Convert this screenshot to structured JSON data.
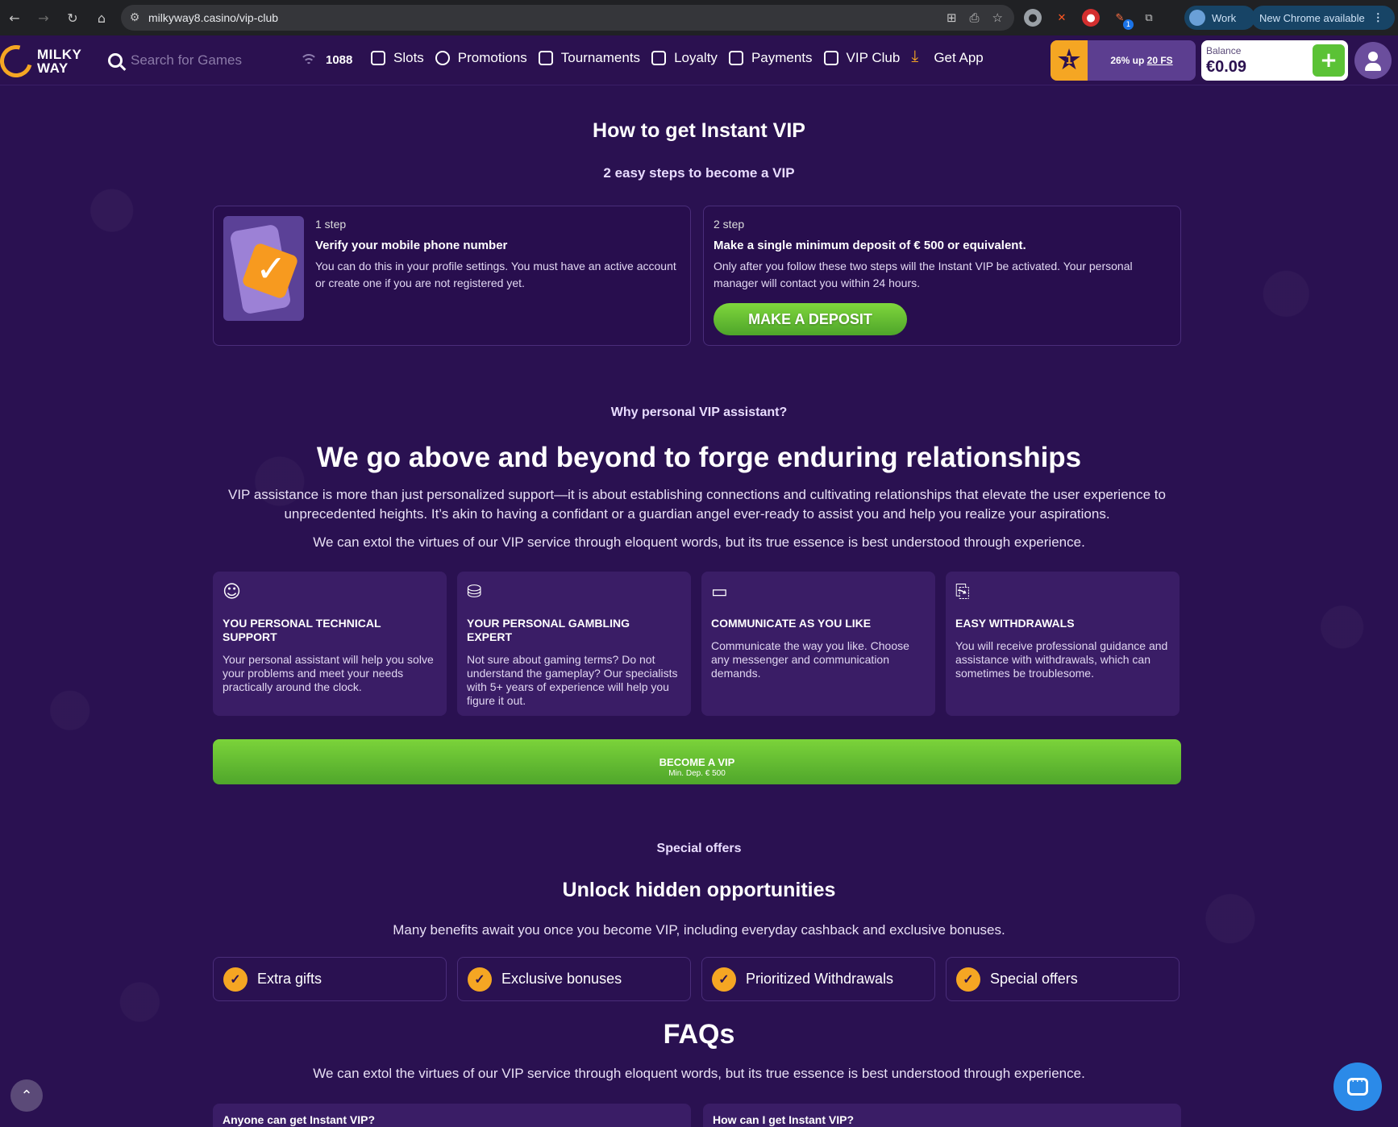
{
  "browser": {
    "url": "milkyway8.casino/vip-club",
    "profile_label": "Work",
    "update_label": "New Chrome available",
    "extension_badge": "1"
  },
  "header": {
    "logo_line1": "MILKY",
    "logo_line2": "WAY",
    "search_placeholder": "Search for Games",
    "online_count": "1088",
    "nav": [
      {
        "label": "Slots",
        "icon": "slot-machine-icon"
      },
      {
        "label": "Promotions",
        "icon": "promotion-icon"
      },
      {
        "label": "Tournaments",
        "icon": "trophy-icon"
      },
      {
        "label": "Loyalty",
        "icon": "loyalty-icon"
      },
      {
        "label": "Payments",
        "icon": "wallet-icon"
      },
      {
        "label": "VIP Club",
        "icon": "vip-icon"
      },
      {
        "label": "Get App",
        "icon": "download-icon"
      }
    ],
    "loyalty": {
      "level": "1",
      "text_pre": "26% up",
      "text_link": "20 FS"
    },
    "balance": {
      "label": "Balance",
      "value": "€0.09"
    }
  },
  "instant_vip": {
    "title": "How to get Instant VIP",
    "subtitle": "2 easy steps to become a VIP",
    "steps": [
      {
        "num": "1 step",
        "title": "Verify your mobile phone number",
        "text": "You can do this in your profile settings. You must have an active account or create one if you are not registered yet."
      },
      {
        "num": "2 step",
        "title": "Make a single minimum deposit of € 500 or equivalent.",
        "text": "Only after you follow these two steps will the Instant VIP be activated. Your personal manager will contact you within 24 hours.",
        "button": "MAKE A DEPOSIT"
      }
    ]
  },
  "why": {
    "eyebrow": "Why personal VIP assistant?",
    "title": "We go above and beyond to forge enduring relationships",
    "para1": "VIP assistance is more than just personalized support—it is about establishing connections and cultivating relationships that elevate the user experience to unprecedented heights. It’s akin to having a confidant or a guardian angel ever-ready to assist you and help you realize your aspirations.",
    "para2": "We can extol the virtues of our VIP service through eloquent words, but its true essence is best understood through experience.",
    "features": [
      {
        "icon": "support-icon",
        "title": "YOU PERSONAL TECHNICAL SUPPORT",
        "text": "Your personal assistant will help you solve your problems and meet your needs practically around the clock."
      },
      {
        "icon": "chip-icon",
        "title": "YOUR PERSONAL GAMBLING EXPERT",
        "text": "Not sure about gaming terms? Do not understand the gameplay? Our specialists with 5+ years of experience will help you figure it out."
      },
      {
        "icon": "chat-icon",
        "title": "COMMUNICATE AS YOU LIKE",
        "text": "Communicate the way you like. Choose any messenger and communication demands."
      },
      {
        "icon": "withdraw-icon",
        "title": "EASY WITHDRAWALS",
        "text": "You will receive professional guidance and assistance with withdrawals, which can sometimes be troublesome."
      }
    ],
    "cta_label": "BECOME A VIP",
    "cta_sub": "Min. Dep. € 500"
  },
  "offers": {
    "eyebrow": "Special offers",
    "title": "Unlock hidden opportunities",
    "text": "Many benefits await you once you become VIP, including everyday cashback and exclusive bonuses.",
    "items": [
      "Extra gifts",
      "Exclusive bonuses",
      "Prioritized Withdrawals",
      "Special offers"
    ]
  },
  "faqs": {
    "title": "FAQs",
    "text": "We can extol the virtues of our VIP service through eloquent words, but its true essence is best understood through experience.",
    "questions": [
      "Anyone can get Instant VIP?",
      "How can I get Instant VIP?"
    ]
  }
}
